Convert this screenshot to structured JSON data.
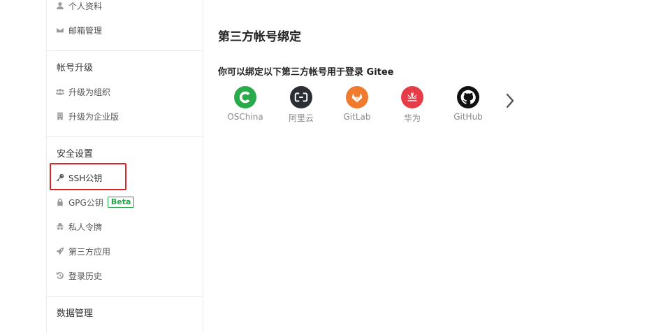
{
  "sidebar": {
    "profile_label": "个人资料",
    "email_label": "邮箱管理",
    "upgrade_heading": "帐号升级",
    "upgrade_org_label": "升级为组织",
    "upgrade_enterprise_label": "升级为企业版",
    "security_heading": "安全设置",
    "ssh_label": "SSH公钥",
    "gpg_label": "GPG公钥",
    "gpg_badge": "Beta",
    "token_label": "私人令牌",
    "third_app_label": "第三方应用",
    "login_history_label": "登录历史",
    "data_heading": "数据管理"
  },
  "main": {
    "title": "第三方帐号绑定",
    "subtitle": "你可以绑定以下第三方帐号用于登录 Gitee",
    "providers": [
      {
        "name": "OSChina",
        "icon": "oschina-icon",
        "color": "#2aab4b"
      },
      {
        "name": "阿里云",
        "icon": "aliyun-icon",
        "color": "#2b2f33"
      },
      {
        "name": "GitLab",
        "icon": "gitlab-icon",
        "color": "#f07a2e"
      },
      {
        "name": "华为",
        "icon": "huawei-icon",
        "color": "#e63c47"
      },
      {
        "name": "GitHub",
        "icon": "github-icon",
        "color": "#111111"
      }
    ]
  },
  "colors": {
    "highlight": "#d9252a",
    "beta": "#21a548"
  }
}
